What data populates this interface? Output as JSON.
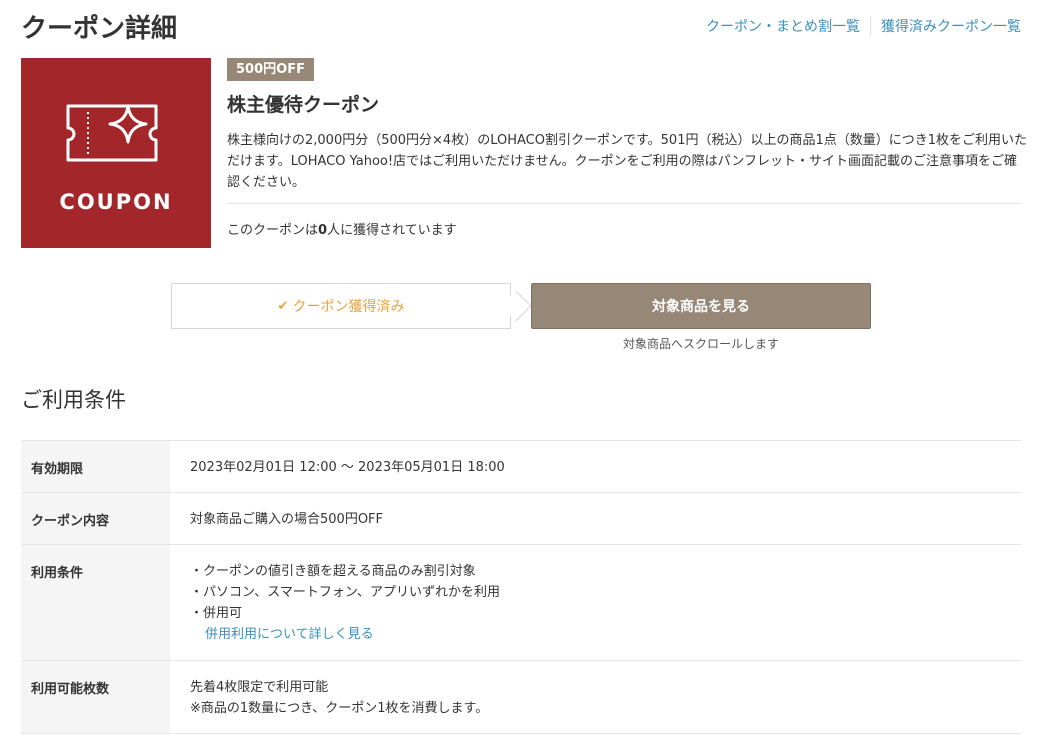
{
  "page_title": "クーポン詳細",
  "top_links": {
    "coupon_list": "クーポン・まとめ割一覧",
    "acquired_list": "獲得済みクーポン一覧"
  },
  "coupon": {
    "image_label": "COUPON",
    "image_color": "#a3272a",
    "badge": "500円OFF",
    "name": "株主優待クーポン",
    "description": "株主様向けの2,000円分（500円分×4枚）のLOHACO割引クーポンです。501円（税込）以上の商品1点（数量）につき1枚をご利用いただけます。LOHACO Yahoo!店ではご利用いただけません。クーポンをご利用の際はパンフレット・サイト画面記載のご注意事項をご確認ください。",
    "acquired_prefix": "このクーポンは",
    "acquired_count": "0",
    "acquired_suffix": "人に獲得されています"
  },
  "actions": {
    "acquired_label": "クーポン獲得済み",
    "view_products_label": "対象商品を見る",
    "scroll_note": "対象商品へスクロールします"
  },
  "terms": {
    "section_title": "ご利用条件",
    "rows": [
      {
        "label": "有効期限",
        "lines": [
          "2023年02月01日 12:00 〜 2023年05月01日 18:00"
        ]
      },
      {
        "label": "クーポン内容",
        "lines": [
          "対象商品ご購入の場合500円OFF"
        ]
      },
      {
        "label": "利用条件",
        "lines": [
          "・クーポンの値引き額を超える商品のみ割引対象",
          "・パソコン、スマートフォン、アプリいずれかを利用",
          "・併用可"
        ],
        "link": "併用利用について詳しく見る"
      },
      {
        "label": "利用可能枚数",
        "lines": [
          "先着4枚限定で利用可能",
          "※商品の1数量につき、クーポン1枚を消費します。"
        ]
      }
    ]
  },
  "colors": {
    "accent_brown": "#968777",
    "link_blue": "#3a8fbf",
    "acquired_orange": "#e8a33a"
  }
}
